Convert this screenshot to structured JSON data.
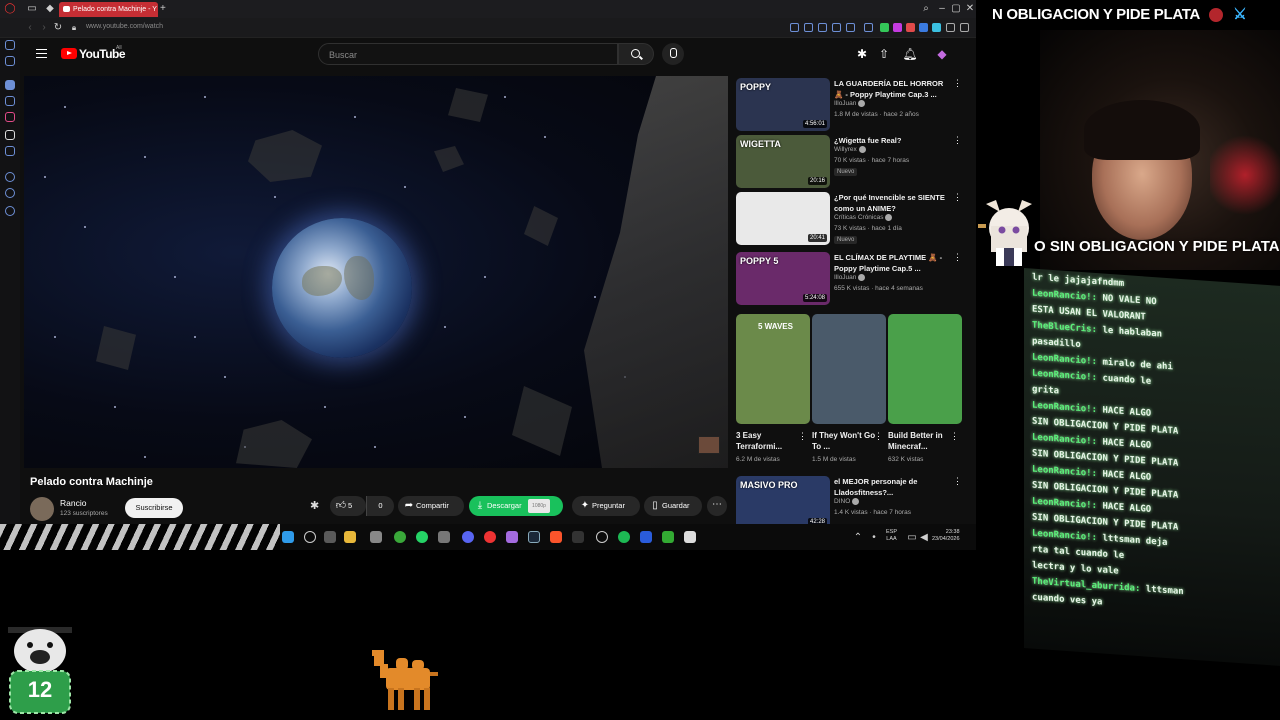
{
  "browser": {
    "tab_title": "Pelado contra Machinje - Y",
    "new_tab": "+",
    "url": "www.youtube.com/watch"
  },
  "youtube": {
    "logo_text": "YouTube",
    "logo_superscript": "All",
    "search_placeholder": "Buscar"
  },
  "video": {
    "title": "Pelado contra Machinje",
    "channel": "Rancio",
    "subscribers": "123 suscriptores",
    "subscribe_label": "Suscribirse",
    "likes": "5",
    "dislikes": "0",
    "share_label": "Compartir",
    "download_label": "Descargar",
    "download_quality": "1080p",
    "ask_label": "Preguntar",
    "save_label": "Guardar"
  },
  "recommendations": [
    {
      "title": "LA GUARDERÍA DEL HORROR 🧸 - Poppy Playtime Cap.3 ...",
      "channel": "IlloJuan",
      "meta": "1.8 M de vistas · hace 2 años",
      "duration": "4:56:01",
      "badge": "",
      "thumb_color": "#2b3450",
      "thumb_label": "POPPY"
    },
    {
      "title": "¿Wigetta fue Real?",
      "channel": "Willyrex",
      "meta": "70 K vistas · hace 7 horas",
      "duration": "20:16",
      "badge": "Nuevo",
      "thumb_color": "#4b5a3a",
      "thumb_label": "WIGETTA"
    },
    {
      "title": "¿Por qué Invencible se SIENTE como un ANIME?",
      "channel": "Críticas Crónicas",
      "meta": "73 K vistas · hace 1 día",
      "duration": "20:41",
      "badge": "Nuevo",
      "thumb_color": "#e9e9e9",
      "thumb_label": ""
    },
    {
      "title": "EL CLÍMAX DE PLAYTIME 🧸 - Poppy Playtime Cap.5 ...",
      "channel": "IlloJuan",
      "meta": "655 K vistas · hace 4 semanas",
      "duration": "5:24:08",
      "badge": "",
      "thumb_color": "#6a2a6a",
      "thumb_label": "POPPY 5"
    },
    {
      "title": "el MEJOR personaje de Lladosfitness?...",
      "channel": "DINO",
      "meta": "1.4 K vistas · hace 7 horas",
      "duration": "42:28",
      "badge": "",
      "thumb_color": "#2a3a66",
      "thumb_label": "MASIVO PRO"
    }
  ],
  "shorts": [
    {
      "title": "3 Easy Terraformi...",
      "meta": "6.2 M de vistas",
      "thumb_color": "#6b8a4a",
      "thumb_label": "5 WAVES"
    },
    {
      "title": "If They Won't Go To ...",
      "meta": "1.5 M de vistas",
      "thumb_color": "#4a5a6a",
      "thumb_label": ""
    },
    {
      "title": "Build Better in Minecraf...",
      "meta": "632 K vistas",
      "thumb_color": "#4aa04a",
      "thumb_label": ""
    }
  ],
  "taskbar": {
    "lang_top": "ESP",
    "lang_bottom": "LAA",
    "time": "23:38",
    "date": "23/04/2026"
  },
  "stream": {
    "banner_top": "N OBLIGACION Y PIDE PLATA",
    "banner_mid": "O SIN OBLIGACION Y PIDE PLATA",
    "chat_lines": [
      {
        "user": "",
        "text": "lr le jajajafndmm"
      },
      {
        "user": "LeonRancio!:",
        "text": "NO VALE NO"
      },
      {
        "user": "",
        "text": "ESTA USAN EL VALORANT"
      },
      {
        "user": "TheBlueCris:",
        "text": "le hablaban"
      },
      {
        "user": "",
        "text": "pasadillo"
      },
      {
        "user": "LeonRancio!:",
        "text": "miralo de ahi"
      },
      {
        "user": "LeonRancio!:",
        "text": "cuando le"
      },
      {
        "user": "",
        "text": "grita"
      },
      {
        "user": "LeonRancio!:",
        "text": "HACE ALGO"
      },
      {
        "user": "",
        "text": "SIN OBLIGACION Y PIDE PLATA"
      },
      {
        "user": "LeonRancio!:",
        "text": "HACE ALGO"
      },
      {
        "user": "",
        "text": "SIN OBLIGACION Y PIDE PLATA"
      },
      {
        "user": "LeonRancio!:",
        "text": "HACE ALGO"
      },
      {
        "user": "",
        "text": "SIN OBLIGACION Y PIDE PLATA"
      },
      {
        "user": "LeonRancio!:",
        "text": "HACE ALGO"
      },
      {
        "user": "",
        "text": "SIN OBLIGACION Y PIDE PLATA"
      },
      {
        "user": "LeonRancio!:",
        "text": "lttsman deja"
      },
      {
        "user": "",
        "text": "rta tal cuando le"
      },
      {
        "user": "",
        "text": "lectra y lo vale"
      },
      {
        "user": "TheVirtual_aburrida:",
        "text": "lttsman"
      },
      {
        "user": "",
        "text": "cuando ves ya"
      }
    ],
    "dog_number": "12"
  },
  "colors": {
    "accent_red": "#ff0000",
    "download_green": "#19c15c",
    "chat_user": "#5bf07a"
  }
}
